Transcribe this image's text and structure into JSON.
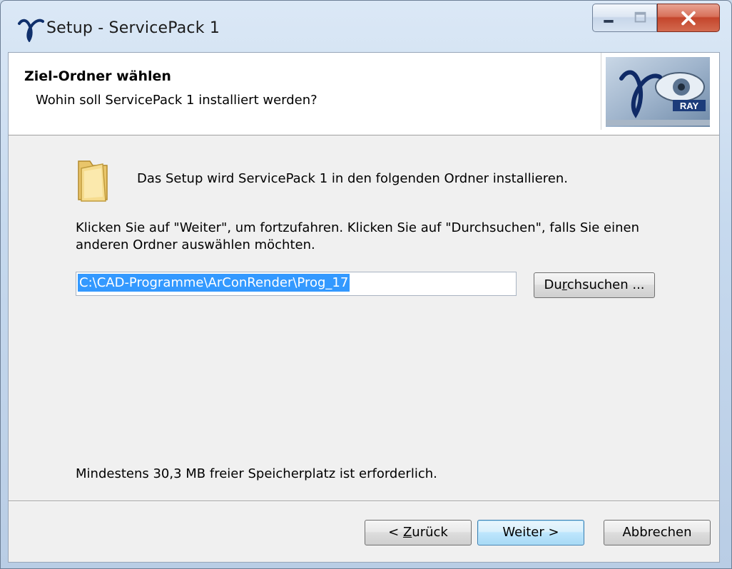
{
  "window": {
    "title": "Setup - ServicePack 1",
    "title_icon": "xray-logo-icon",
    "controls": [
      "minimize",
      "maximize",
      "close"
    ]
  },
  "header": {
    "title": "Ziel-Ordner wählen",
    "subtitle": "Wohin soll ServicePack 1 installiert werden?",
    "logo_text": "RAY"
  },
  "body": {
    "folder_icon": "folder-icon",
    "intro": "Das Setup wird ServicePack 1 in den folgenden Ordner installieren.",
    "instructions": "Klicken Sie auf \"Weiter\", um fortzufahren. Klicken Sie auf \"Durchsuchen\", falls Sie einen anderen Ordner auswählen möchten.",
    "path_value": "C:\\CAD-Programme\\ArConRender\\Prog_17",
    "browse_pre": "Du",
    "browse_key": "r",
    "browse_post": "chsuchen ...",
    "space_required": "Mindestens 30,3 MB freier Speicherplatz ist erforderlich."
  },
  "footer": {
    "back_pre": "< ",
    "back_key": "Z",
    "back_post": "urück",
    "next_label": "Weiter >",
    "cancel_label": "Abbrechen"
  },
  "colors": {
    "selection": "#3399ff",
    "close_button": "#c4452c"
  }
}
